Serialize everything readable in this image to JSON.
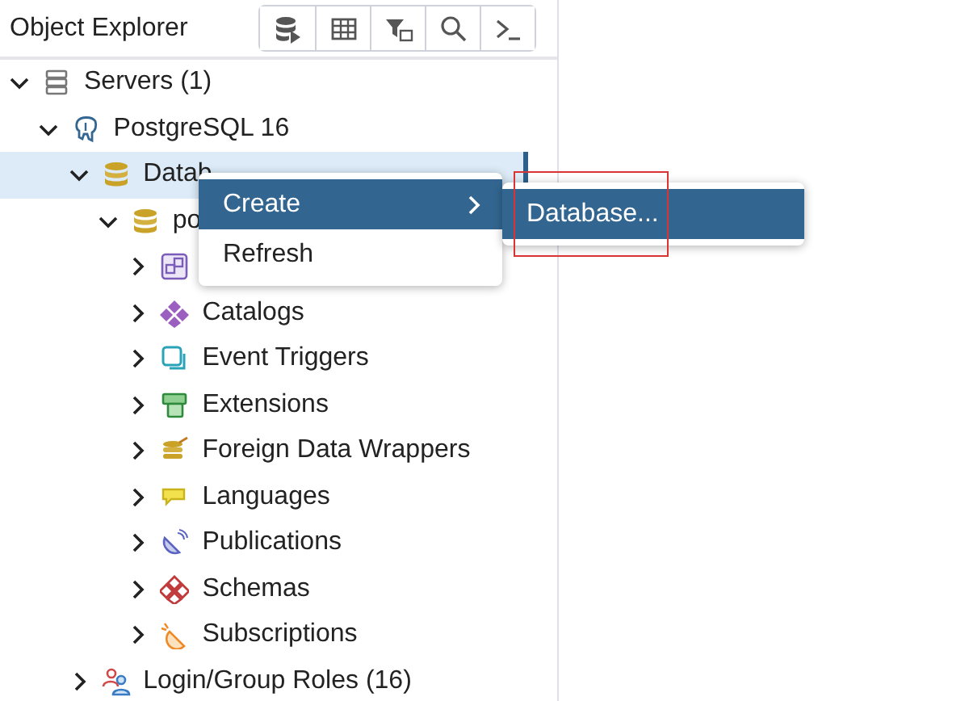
{
  "panel": {
    "title": "Object Explorer"
  },
  "tree": [
    {
      "label": "Servers (1)",
      "kind": "servers",
      "expanded": true,
      "selected": false,
      "children": [
        {
          "label": "PostgreSQL 16",
          "kind": "postgres",
          "expanded": true,
          "selected": false,
          "children": [
            {
              "label": "Datab",
              "kind": "database",
              "expanded": true,
              "selected": true,
              "children": [
                {
                  "label": "po",
                  "kind": "database",
                  "expanded": true,
                  "selected": false,
                  "children": [
                    {
                      "kind": "cast",
                      "expanded": false,
                      "selected": false
                    },
                    {
                      "label": "Catalogs",
                      "kind": "catalog",
                      "expanded": false,
                      "selected": false
                    },
                    {
                      "label": "Event Triggers",
                      "kind": "event_trigger",
                      "expanded": false,
                      "selected": false
                    },
                    {
                      "label": "Extensions",
                      "kind": "extension",
                      "expanded": false,
                      "selected": false
                    },
                    {
                      "label": "Foreign Data Wrappers",
                      "kind": "fdw",
                      "expanded": false,
                      "selected": false
                    },
                    {
                      "label": "Languages",
                      "kind": "language",
                      "expanded": false,
                      "selected": false
                    },
                    {
                      "label": "Publications",
                      "kind": "publication",
                      "expanded": false,
                      "selected": false
                    },
                    {
                      "label": "Schemas",
                      "kind": "schema",
                      "expanded": false,
                      "selected": false
                    },
                    {
                      "label": "Subscriptions",
                      "kind": "subscription",
                      "expanded": false,
                      "selected": false
                    }
                  ]
                }
              ]
            },
            {
              "label": "Login/Group Roles (16)",
              "kind": "role",
              "expanded": false,
              "selected": false
            }
          ]
        }
      ]
    }
  ],
  "context_menu": {
    "items": [
      {
        "label": "Create",
        "selected": true,
        "has_submenu": true
      },
      {
        "label": "Refresh",
        "selected": false,
        "has_submenu": false
      }
    ]
  },
  "submenu": {
    "items": [
      {
        "label": "Database...",
        "selected": true
      }
    ]
  }
}
